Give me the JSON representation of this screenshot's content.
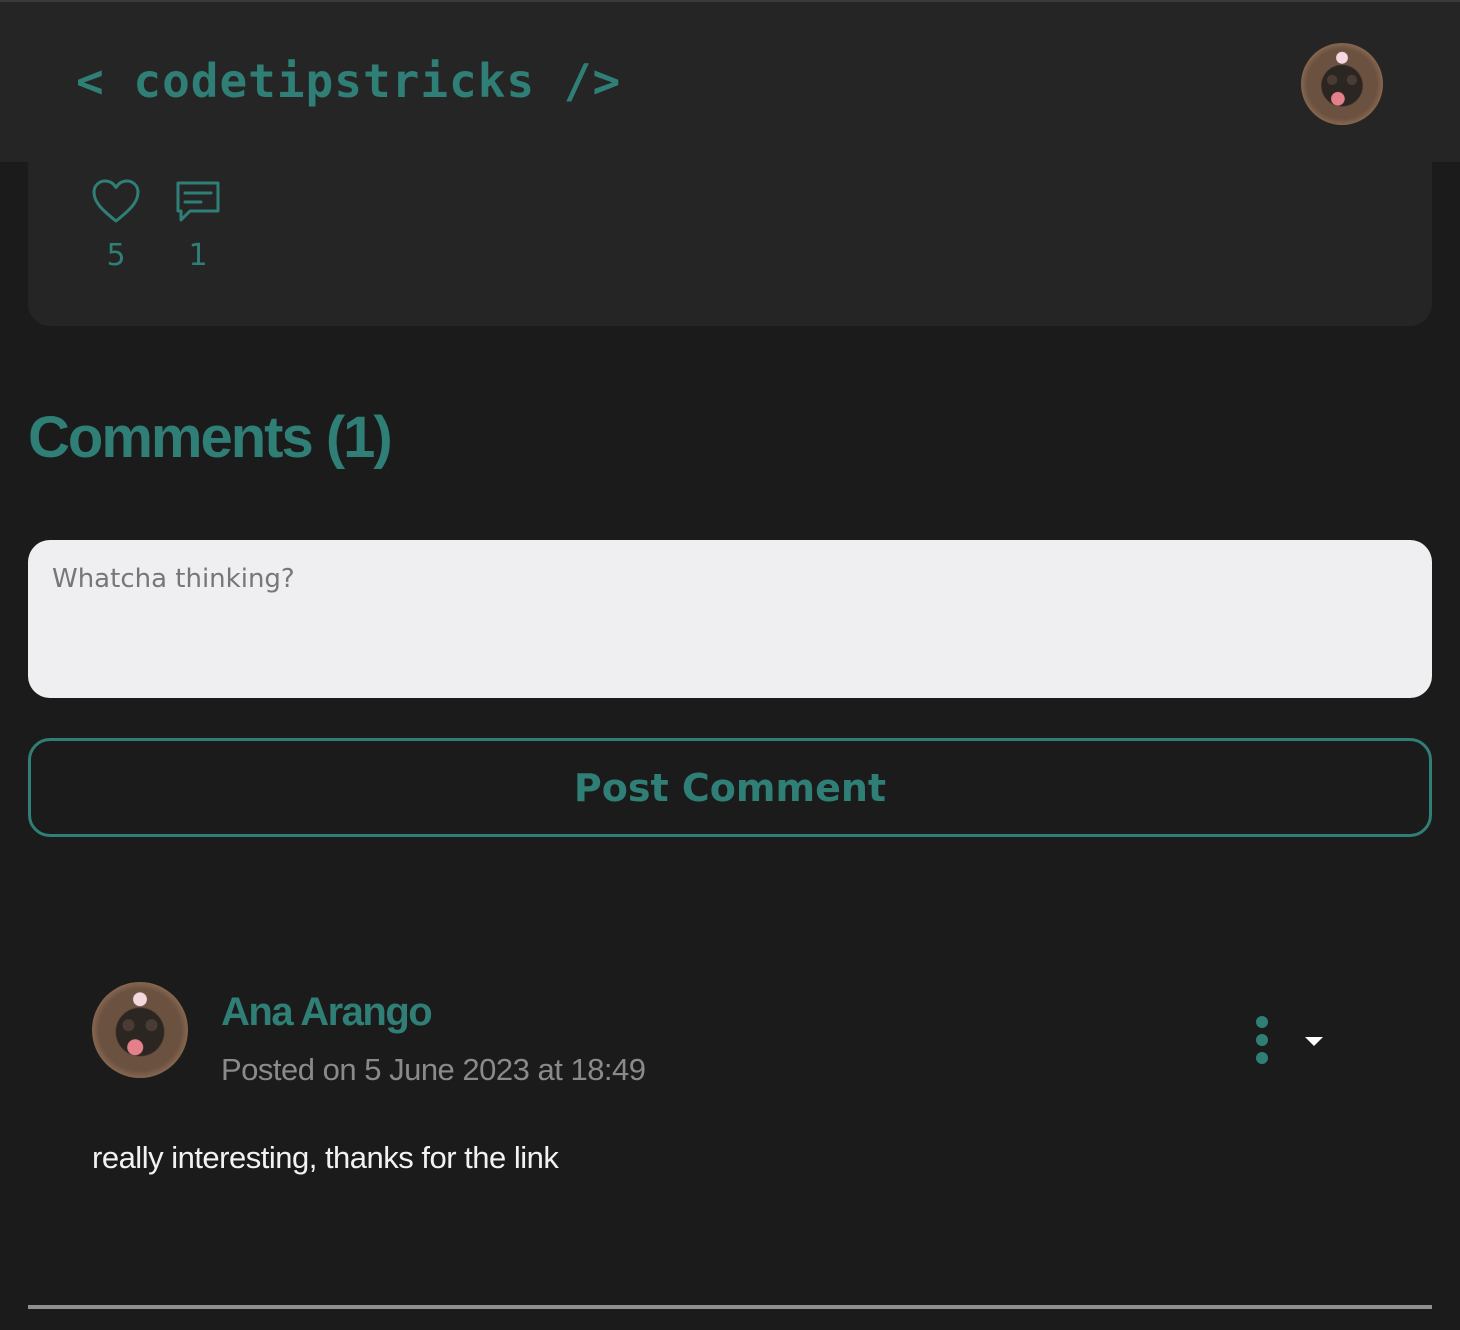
{
  "header": {
    "logo_text": "< codetipstricks />",
    "avatar_icon": "user-avatar-dog-photo"
  },
  "post_stats": {
    "likes": {
      "icon": "heart-icon",
      "count": "5"
    },
    "comments": {
      "icon": "comment-bubble-icon",
      "count": "1"
    }
  },
  "comments_section": {
    "heading": "Comments (1)",
    "input": {
      "placeholder": "Whatcha thinking?",
      "value": ""
    },
    "post_button_label": "Post Comment",
    "items": [
      {
        "author": "Ana Arango",
        "meta": "Posted on 5 June 2023 at 18:49",
        "body": "really interesting, thanks for the link",
        "menu_icon": "kebab-menu-icon",
        "dropdown_icon": "caret-down-icon"
      }
    ]
  },
  "colors": {
    "accent": "#2f7f77",
    "background": "#1b1b1b",
    "card": "#252525",
    "input_bg": "#efeff2"
  }
}
